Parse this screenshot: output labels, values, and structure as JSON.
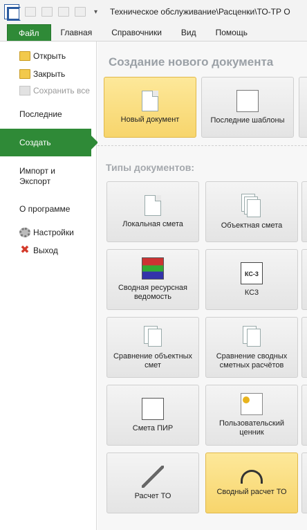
{
  "window": {
    "title": "Техническое обслуживание\\Расценки\\ТО-ТР О"
  },
  "ribbon": {
    "tabs": [
      {
        "label": "Файл",
        "active": true
      },
      {
        "label": "Главная"
      },
      {
        "label": "Справочники"
      },
      {
        "label": "Вид"
      },
      {
        "label": "Помощь"
      }
    ]
  },
  "backstage": {
    "items": [
      {
        "label": "Открыть",
        "icon": "folder-open-icon"
      },
      {
        "label": "Закрыть",
        "icon": "folder-close-icon"
      },
      {
        "label": "Сохранить все",
        "icon": "save-all-icon",
        "disabled": true
      }
    ],
    "recent": "Последние",
    "create": "Создать",
    "import_export": "Импорт и Экспорт",
    "about": "О программе",
    "settings": "Настройки",
    "exit": "Выход"
  },
  "create_panel": {
    "heading": "Создание нового документа",
    "new_document": "Новый документ",
    "recent_templates": "Последние шаблоны",
    "types_heading": "Типы документов:",
    "types": [
      "Локальная смета",
      "Объектная смета",
      "Сводная ресурсная ведомость",
      "КС3",
      "Сравнение объектных смет",
      "Сравнение сводных сметных расчётов",
      "Смета ПИР",
      "Пользовательский ценник",
      "Расчет ТО",
      "Сводный расчет ТО"
    ]
  },
  "colors": {
    "accent": "#2f8a37",
    "selected_tile": "#f7d56c"
  }
}
